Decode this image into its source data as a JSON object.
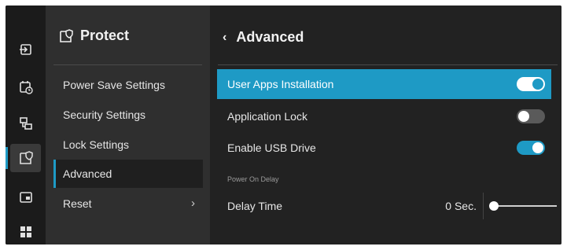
{
  "rail": {
    "items": [
      {
        "icon": "input-icon"
      },
      {
        "icon": "schedule-icon"
      },
      {
        "icon": "network-icon"
      },
      {
        "icon": "protect-icon",
        "active": true
      },
      {
        "icon": "display-icon"
      },
      {
        "icon": "apps-grid-icon"
      }
    ]
  },
  "sidebar": {
    "title": "Protect",
    "items": [
      {
        "label": "Power Save Settings"
      },
      {
        "label": "Security Settings"
      },
      {
        "label": "Lock Settings"
      },
      {
        "label": "Advanced",
        "active": true
      },
      {
        "label": "Reset",
        "chevron": "›"
      }
    ]
  },
  "main": {
    "back_glyph": "‹",
    "title": "Advanced",
    "settings": [
      {
        "label": "User Apps Installation",
        "state": "on",
        "highlighted": true
      },
      {
        "label": "Application Lock",
        "state": "off"
      },
      {
        "label": "Enable USB Drive",
        "state": "on"
      }
    ],
    "section_label": "Power On Delay",
    "delay": {
      "label": "Delay Time",
      "value": "0 Sec.",
      "slider_fraction": 0
    }
  },
  "colors": {
    "accent": "#1e9ac5",
    "background": "#222222",
    "sidebar": "#2f2f2f",
    "rail": "#1b1b1b"
  }
}
